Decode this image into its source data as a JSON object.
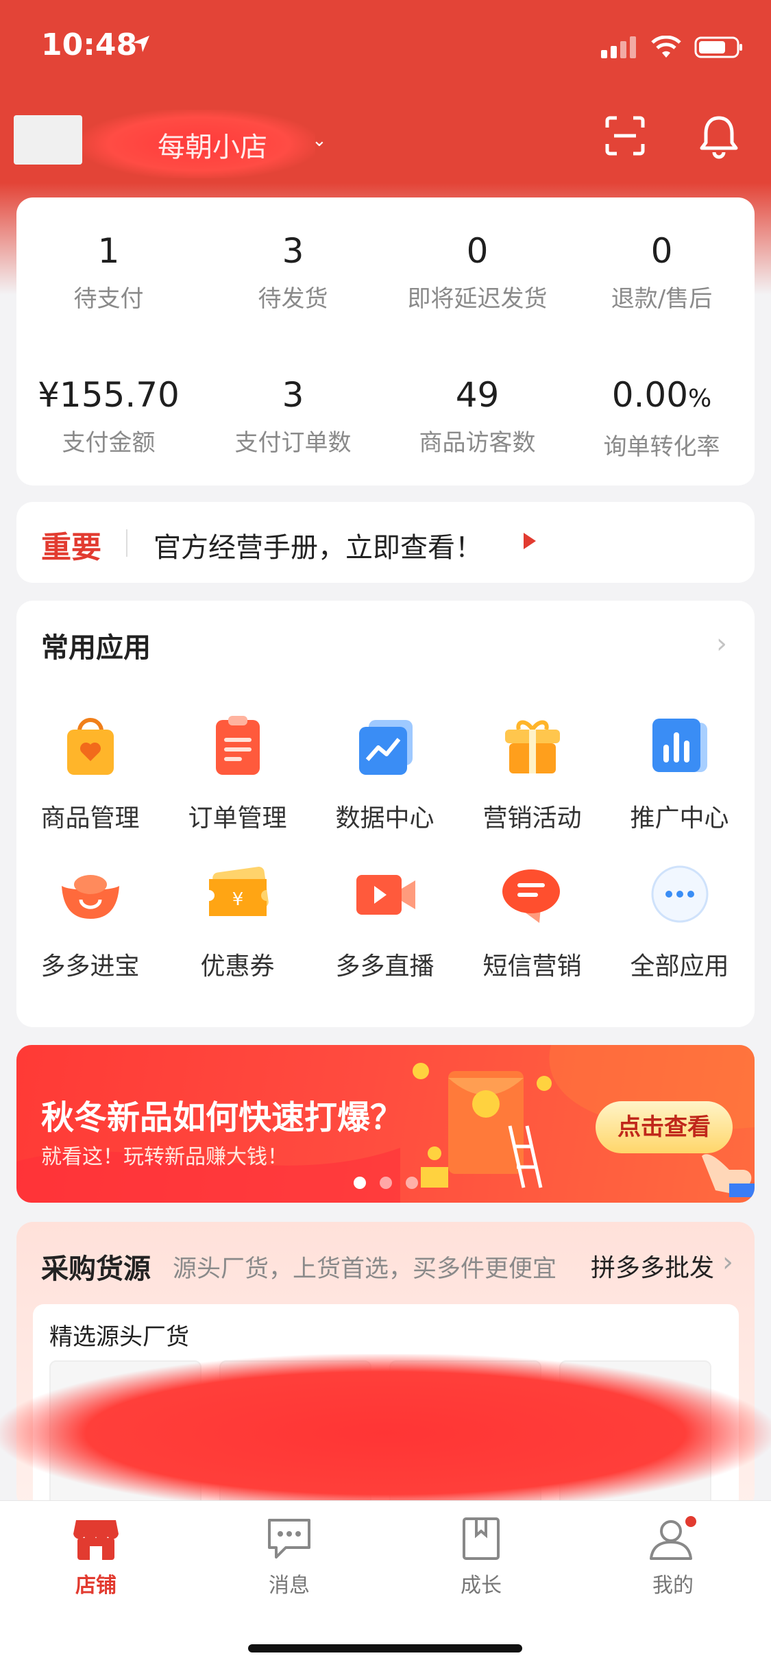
{
  "status": {
    "time": "10:48"
  },
  "shop": {
    "name": "每朝小店"
  },
  "stats": [
    {
      "value": "1",
      "label": "待支付"
    },
    {
      "value": "3",
      "label": "待发货"
    },
    {
      "value": "0",
      "label": "即将延迟发货"
    },
    {
      "value": "0",
      "label": "退款/售后"
    },
    {
      "value": "¥155.70",
      "label": "支付金额"
    },
    {
      "value": "3",
      "label": "支付订单数"
    },
    {
      "value": "49",
      "label": "商品访客数"
    },
    {
      "value": "0.00",
      "suffix": "%",
      "label": "询单转化率"
    }
  ],
  "notice": {
    "tag": "重要",
    "text": "官方经营手册，立即查看！"
  },
  "apps": {
    "title": "常用应用",
    "items": [
      {
        "label": "商品管理",
        "icon": "shopping-bag-icon"
      },
      {
        "label": "订单管理",
        "icon": "order-list-icon"
      },
      {
        "label": "数据中心",
        "icon": "chart-icon"
      },
      {
        "label": "营销活动",
        "icon": "gift-icon"
      },
      {
        "label": "推广中心",
        "icon": "bar-chart-icon"
      },
      {
        "label": "多多进宝",
        "icon": "ingot-icon"
      },
      {
        "label": "优惠券",
        "icon": "coupon-icon"
      },
      {
        "label": "多多直播",
        "icon": "live-video-icon"
      },
      {
        "label": "短信营销",
        "icon": "sms-icon"
      },
      {
        "label": "全部应用",
        "icon": "more-icon"
      }
    ]
  },
  "banner": {
    "title": "秋冬新品如何快速打爆？",
    "subtitle": "就看这！玩转新品赚大钱！",
    "button": "点击查看",
    "slides": 3,
    "active_slide": 1
  },
  "source": {
    "title": "采购货源",
    "desc": "源头厂货，上货首选，买多件更便宜",
    "link": "拼多多批发",
    "panel_title": "精选源头厂货"
  },
  "tabs": [
    {
      "label": "店铺",
      "icon": "store-icon",
      "active": true
    },
    {
      "label": "消息",
      "icon": "message-icon",
      "active": false
    },
    {
      "label": "成长",
      "icon": "book-icon",
      "active": false
    },
    {
      "label": "我的",
      "icon": "user-icon",
      "active": false,
      "badge": true
    }
  ],
  "colors": {
    "brand": "#e34437",
    "accent": "#e23b30"
  }
}
